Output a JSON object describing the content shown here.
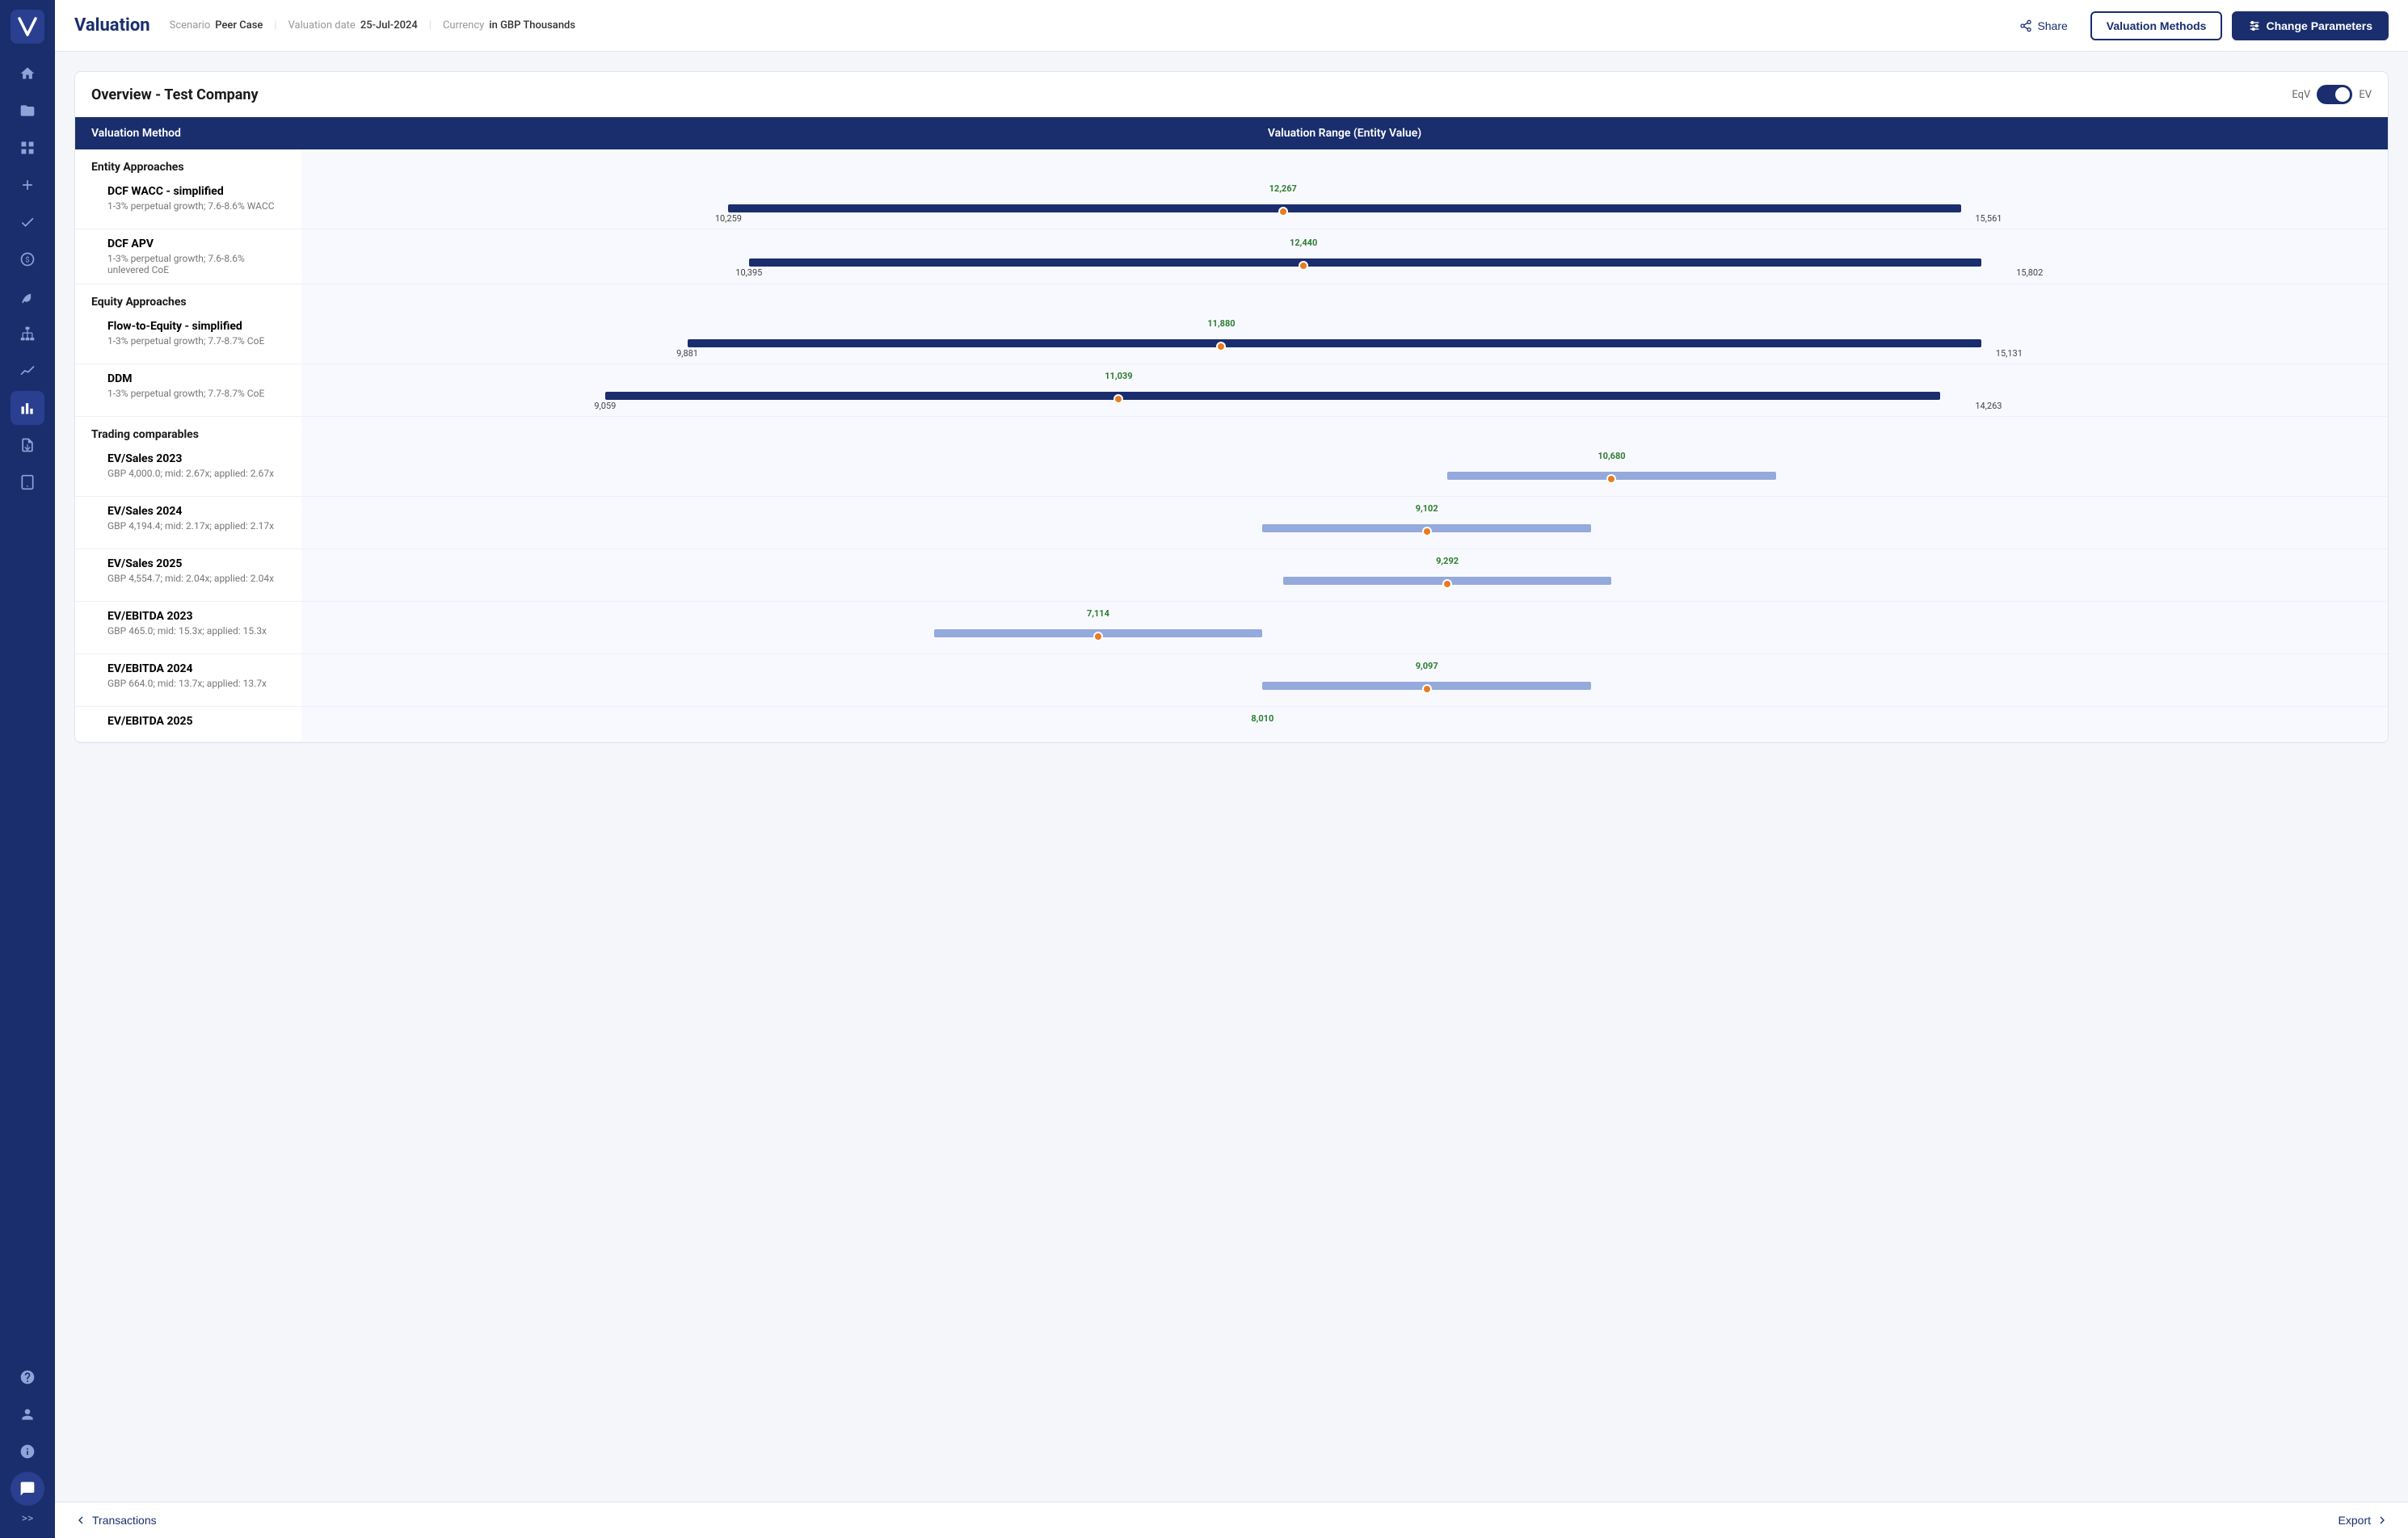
{
  "app": {
    "name": "V",
    "logo_color": "#1a2e6e"
  },
  "sidebar": {
    "icons": [
      {
        "name": "home-icon",
        "glyph": "🏠",
        "active": false
      },
      {
        "name": "folder-icon",
        "glyph": "📁",
        "active": false
      },
      {
        "name": "grid-icon",
        "glyph": "⊞",
        "active": false
      },
      {
        "name": "plus-icon",
        "glyph": "+",
        "active": false
      },
      {
        "name": "check-icon",
        "glyph": "✓",
        "active": false
      },
      {
        "name": "coin-icon",
        "glyph": "💰",
        "active": false
      },
      {
        "name": "leaf-icon",
        "glyph": "🌿",
        "active": false
      },
      {
        "name": "org-icon",
        "glyph": "⬡",
        "active": false
      },
      {
        "name": "chart-icon",
        "glyph": "📈",
        "active": false
      },
      {
        "name": "bar-chart-icon",
        "glyph": "📊",
        "active": true
      },
      {
        "name": "export-icon",
        "glyph": "📤",
        "active": false
      },
      {
        "name": "tablet-icon",
        "glyph": "📱",
        "active": false
      }
    ],
    "bottom_icons": [
      {
        "name": "question-icon",
        "glyph": "?",
        "active": false
      },
      {
        "name": "user-icon",
        "glyph": "👤",
        "active": false
      },
      {
        "name": "info-icon",
        "glyph": "ℹ",
        "active": false
      },
      {
        "name": "chat-icon",
        "glyph": "💬",
        "active": false
      }
    ],
    "expand_label": ">>"
  },
  "header": {
    "title": "Valuation",
    "scenario_label": "Scenario",
    "scenario_value": "Peer Case",
    "valuation_date_label": "Valuation date",
    "valuation_date_value": "25-Jul-2024",
    "currency_label": "Currency",
    "currency_value": "in GBP Thousands",
    "share_button": "Share",
    "valuation_methods_button": "Valuation Methods",
    "change_parameters_button": "Change Parameters"
  },
  "overview": {
    "title": "Overview - Test Company",
    "toggle_left": "EqV",
    "toggle_right": "EV",
    "toggle_active": "EV",
    "table_header": {
      "col1": "Valuation Method",
      "col2": "Valuation Range (Entity Value)"
    },
    "sections": [
      {
        "category": "Entity Approaches",
        "methods": [
          {
            "name": "DCF WACC - simplified",
            "desc": "1-3% perpetual growth; 7.6-8.6% WACC",
            "min": 10259,
            "mid": 12267,
            "max": 15561,
            "bar_start_pct": 20,
            "bar_width_pct": 65,
            "dot_pct": 47,
            "mid_offset_pct": 47
          },
          {
            "name": "DCF APV",
            "desc": "1-3% perpetual growth; 7.6-8.6% unlevered CoE",
            "min": 10395,
            "mid": 12440,
            "max": 15802,
            "bar_start_pct": 21,
            "bar_width_pct": 64,
            "dot_pct": 47,
            "mid_offset_pct": 47
          }
        ]
      },
      {
        "category": "Equity Approaches",
        "methods": [
          {
            "name": "Flow-to-Equity - simplified",
            "desc": "1-3% perpetual growth; 7.7-8.7% CoE",
            "min": 9881,
            "mid": 11880,
            "max": 15131,
            "bar_start_pct": 18,
            "bar_width_pct": 65,
            "dot_pct": 42,
            "mid_offset_pct": 42
          },
          {
            "name": "DDM",
            "desc": "1-3% perpetual growth; 7.7-8.7% CoE",
            "min": 9059,
            "mid": 11039,
            "max": 14263,
            "bar_start_pct": 14,
            "bar_width_pct": 65,
            "dot_pct": 40,
            "mid_offset_pct": 40
          }
        ]
      },
      {
        "category": "Trading comparables",
        "methods": [
          {
            "name": "EV/Sales 2023",
            "desc": "GBP 4,000.0; mid: 2.67x; applied: 2.67x",
            "min": null,
            "mid": 10680,
            "max": null,
            "bar_start_pct": 55,
            "bar_width_pct": 18,
            "dot_pct": 63,
            "mid_offset_pct": 63,
            "single": true
          },
          {
            "name": "EV/Sales 2024",
            "desc": "GBP 4,194.4; mid: 2.17x; applied: 2.17x",
            "min": null,
            "mid": 9102,
            "max": null,
            "bar_start_pct": 46,
            "bar_width_pct": 18,
            "dot_pct": 54,
            "mid_offset_pct": 54,
            "single": true
          },
          {
            "name": "EV/Sales 2025",
            "desc": "GBP 4,554.7; mid: 2.04x; applied: 2.04x",
            "min": null,
            "mid": 9292,
            "max": null,
            "bar_start_pct": 47,
            "bar_width_pct": 18,
            "dot_pct": 55,
            "mid_offset_pct": 55,
            "single": true
          },
          {
            "name": "EV/EBITDA 2023",
            "desc": "GBP 465.0; mid: 15.3x; applied: 15.3x",
            "min": null,
            "mid": 7114,
            "max": null,
            "bar_start_pct": 30,
            "bar_width_pct": 18,
            "dot_pct": 38,
            "mid_offset_pct": 38,
            "single": true
          },
          {
            "name": "EV/EBITDA 2024",
            "desc": "GBP 664.0; mid: 13.7x; applied: 13.7x",
            "min": null,
            "mid": 9097,
            "max": null,
            "bar_start_pct": 46,
            "bar_width_pct": 18,
            "dot_pct": 54,
            "mid_offset_pct": 54,
            "single": true
          },
          {
            "name": "EV/EBITDA 2025",
            "desc": "",
            "min": null,
            "mid": 8010,
            "max": null,
            "bar_start_pct": 38,
            "bar_width_pct": 18,
            "dot_pct": 46,
            "mid_offset_pct": 46,
            "single": true,
            "partial": true
          }
        ]
      }
    ]
  },
  "footer": {
    "back_label": "Transactions",
    "forward_label": "Export"
  }
}
